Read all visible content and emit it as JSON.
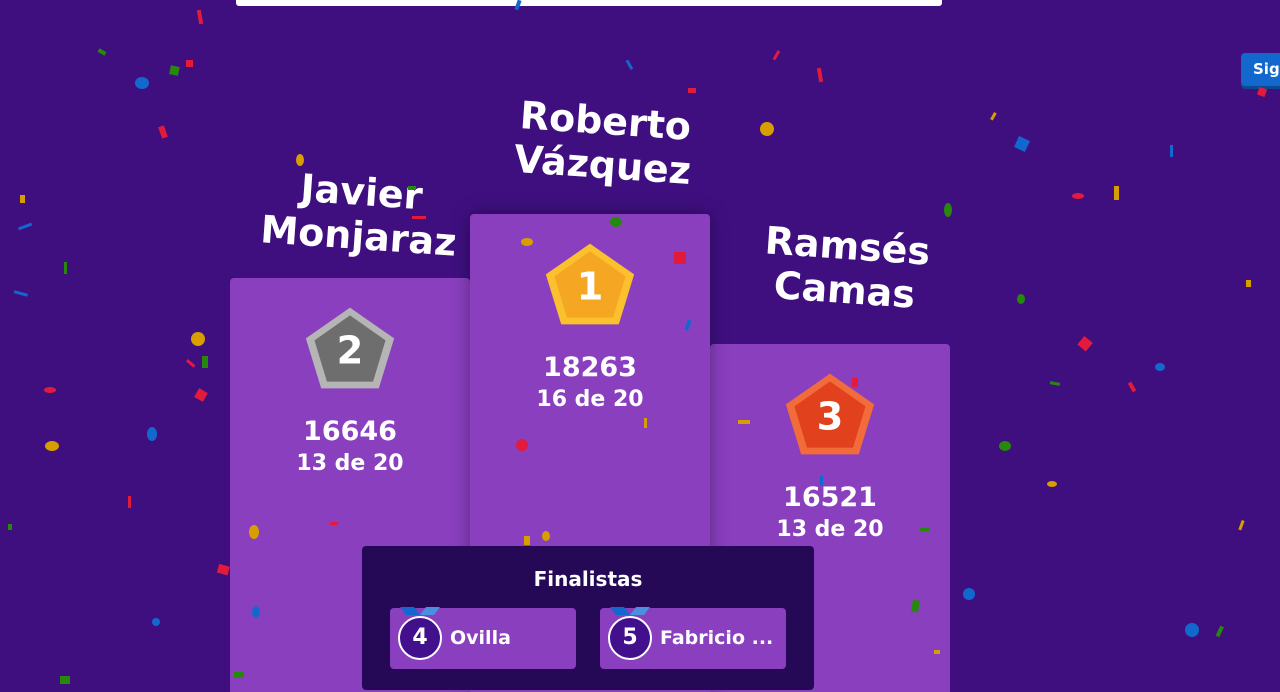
{
  "next_button": {
    "label": "Sig"
  },
  "podium": [
    {
      "rank": "2",
      "name": "Javier Monjaraz",
      "score": "16646",
      "correct": "13 de 20",
      "medal_color": "#7d7d7d"
    },
    {
      "rank": "1",
      "name": "Roberto Vázquez",
      "score": "18263",
      "correct": "16 de 20",
      "medal_color": "#f5a623"
    },
    {
      "rank": "3",
      "name": "Ramsés Camas",
      "score": "16521",
      "correct": "13 de 20",
      "medal_color": "#e2411d"
    }
  ],
  "finalists": {
    "title": "Finalistas",
    "items": [
      {
        "rank": "4",
        "name": "Ovilla"
      },
      {
        "rank": "5",
        "name": "Fabricio ..."
      }
    ]
  },
  "colors": {
    "background": "#3f0f80",
    "podium": "#8a3fbf",
    "finalists_panel": "#260956",
    "next_button": "#1368ce"
  }
}
